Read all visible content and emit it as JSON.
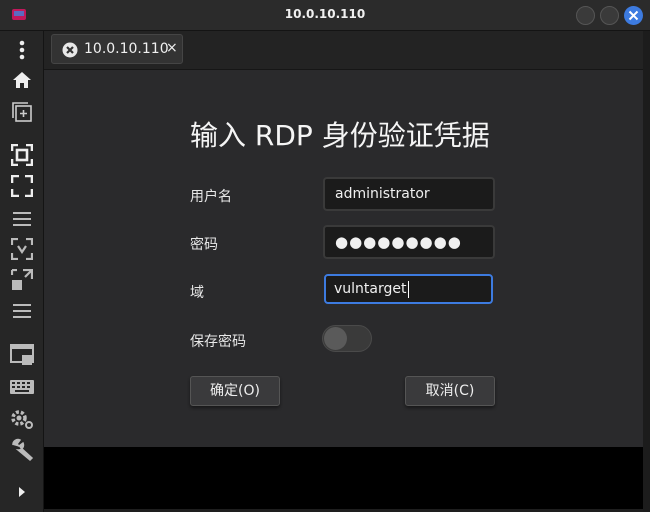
{
  "window": {
    "title": "10.0.10.110",
    "accent": "#3d7be0"
  },
  "sidebar": {
    "items": [
      {
        "icon": "more-vertical-icon"
      },
      {
        "icon": "home-icon"
      },
      {
        "icon": "new-connection-icon"
      },
      {
        "icon": "fit-window-icon"
      },
      {
        "icon": "fullscreen-icon"
      },
      {
        "icon": "menu-icon"
      },
      {
        "icon": "dynamic-resolution-icon"
      },
      {
        "icon": "scale-icon"
      },
      {
        "icon": "menu-icon"
      },
      {
        "icon": "view-icon"
      },
      {
        "icon": "keyboard-icon"
      },
      {
        "icon": "settings-icon"
      },
      {
        "icon": "tools-icon"
      },
      {
        "icon": "expand-icon"
      }
    ]
  },
  "tabs": [
    {
      "label": "10.0.10.110",
      "close": "×"
    }
  ],
  "dialog": {
    "title": "输入 RDP 身份验证凭据",
    "username_label": "用户名",
    "username_value": "administrator",
    "password_label": "密码",
    "password_value": "●●●●●●●●●",
    "domain_label": "域",
    "domain_value": "vulntarget",
    "save_password_label": "保存密码",
    "save_password_on": false,
    "ok_label": "确定(O)",
    "cancel_label": "取消(C)"
  }
}
